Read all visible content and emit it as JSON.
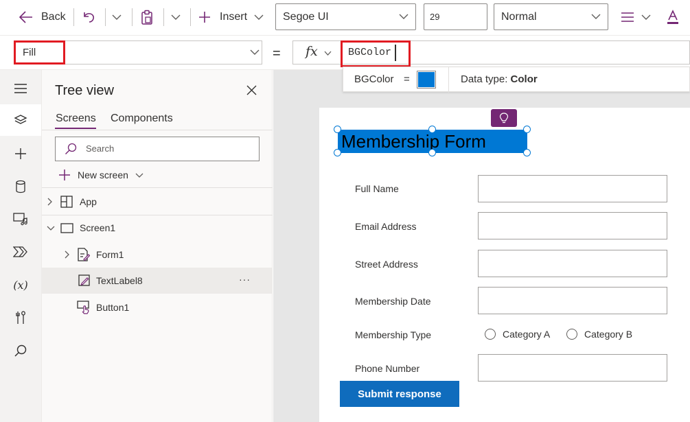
{
  "toolbar": {
    "back_label": "Back",
    "insert_label": "Insert",
    "font_family": "Segoe UI",
    "font_size": "29",
    "font_weight": "Normal"
  },
  "formula_bar": {
    "property": "Fill",
    "formula": "BGColor"
  },
  "intellisense": {
    "name": "BGColor",
    "equals": "=",
    "color_swatch": "#0078d4",
    "datatype_label": "Data type: ",
    "datatype_value": "Color"
  },
  "tree_view": {
    "title": "Tree view",
    "tabs": [
      "Screens",
      "Components"
    ],
    "search_placeholder": "Search",
    "new_screen_label": "New screen",
    "items": [
      {
        "label": "App"
      },
      {
        "label": "Screen1"
      },
      {
        "label": "Form1"
      },
      {
        "label": "TextLabel8"
      },
      {
        "label": "Button1"
      }
    ],
    "more_label": "···"
  },
  "canvas": {
    "title": "Membership Form",
    "fields": [
      "Full Name",
      "Email Address",
      "Street Address",
      "Membership Date",
      "Membership Type",
      "Phone Number"
    ],
    "radio_options": [
      "Category A",
      "Category B"
    ],
    "submit_label": "Submit response"
  },
  "colors": {
    "accent": "#742774",
    "selection": "#0078d4",
    "submit": "#0f6cbd",
    "highlight": "#e11b22"
  }
}
